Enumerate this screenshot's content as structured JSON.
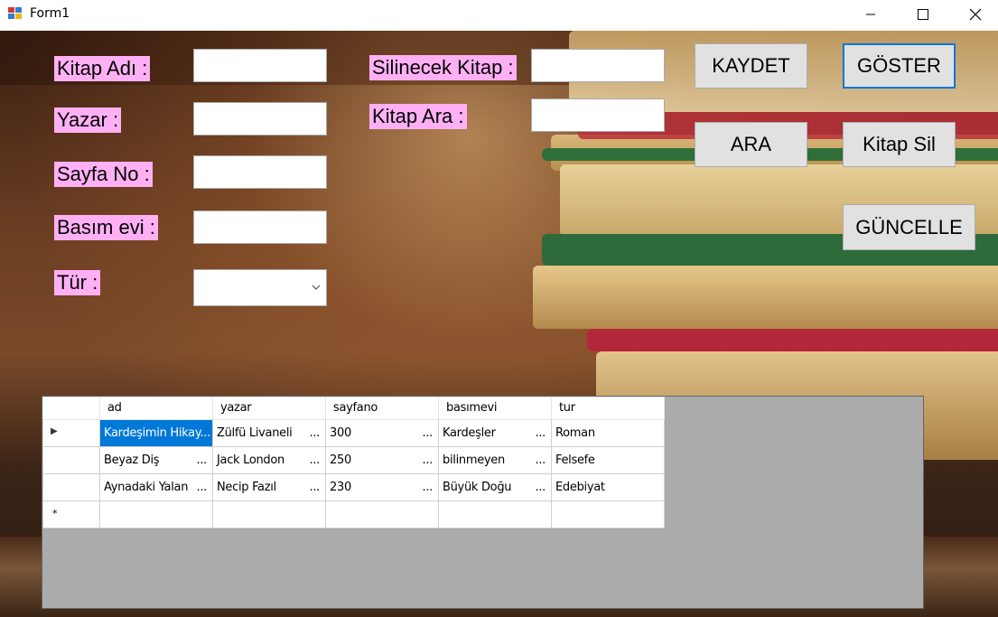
{
  "window": {
    "title": "Form1"
  },
  "labels": {
    "kitap_adi": "Kitap Adı :",
    "yazar": "Yazar :",
    "sayfa_no": "Sayfa No :",
    "basim_evi": "Basım evi :",
    "tur": "Tür :",
    "silinecek_kitap": "Silinecek Kitap :",
    "kitap_ara": "Kitap Ara :"
  },
  "inputs": {
    "kitap_adi": "",
    "yazar": "",
    "sayfa_no": "",
    "basim_evi": "",
    "tur": "",
    "silinecek_kitap": "",
    "kitap_ara": ""
  },
  "buttons": {
    "kaydet": "KAYDET",
    "goster": "GÖSTER",
    "ara": "ARA",
    "kitap_sil": "Kitap Sil",
    "guncelle": "GÜNCELLE"
  },
  "grid": {
    "columns": [
      "ad",
      "yazar",
      "sayfano",
      "basımevi",
      "tur"
    ],
    "rows": [
      [
        "Kardeşimin Hikay...",
        "Zülfü Livaneli",
        "300",
        "Kardeşler",
        "Roman"
      ],
      [
        "Beyaz Diş",
        "Jack London",
        "250",
        "bilinmeyen",
        "Felsefe"
      ],
      [
        "Aynadaki Yalan",
        "Necip Fazıl",
        "230",
        "Büyük Doğu",
        "Edebiyat"
      ]
    ],
    "ellipsis": "...",
    "current_row_marker": "▶",
    "new_row_marker": "*"
  },
  "colors": {
    "label_bg": "#ffb0f5",
    "selection": "#0078d7",
    "grid_bg": "#ababab"
  }
}
